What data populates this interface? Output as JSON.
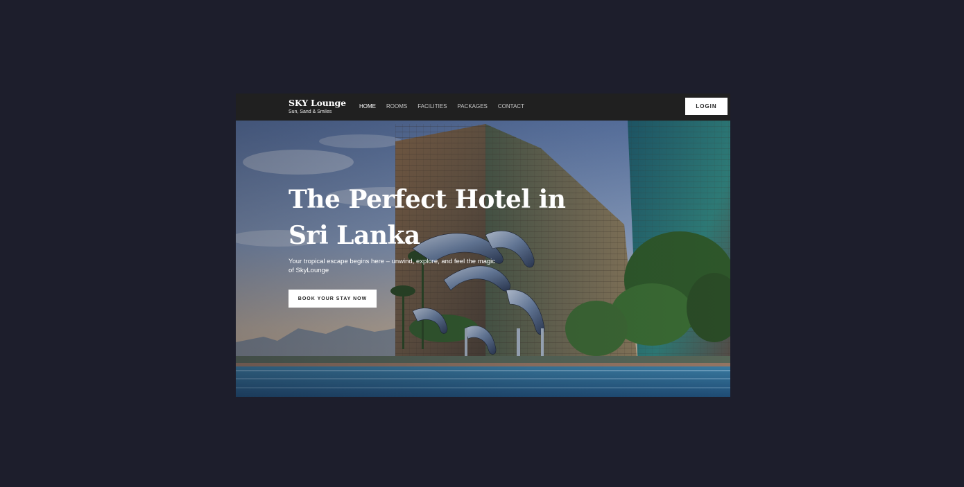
{
  "brand": {
    "name": "SKY Lounge",
    "tagline": "Sun, Sand & Smiles"
  },
  "nav": {
    "items": [
      {
        "label": "HOME",
        "active": true
      },
      {
        "label": "ROOMS",
        "active": false
      },
      {
        "label": "FACILITIES",
        "active": false
      },
      {
        "label": "PACKAGES",
        "active": false
      },
      {
        "label": "CONTACT",
        "active": false
      }
    ],
    "login_label": "LOGIN"
  },
  "hero": {
    "title": "The Perfect Hotel in Sri Lanka",
    "subtitle": "Your tropical escape begins here – unwind, explore, and feel the magic of SkyLounge",
    "cta_label": "BOOK YOUR STAY NOW",
    "image": "hotel-towers-dolphin-fountain-photo"
  },
  "colors": {
    "page_background": "#1d1e2c",
    "navbar_background": "#202020",
    "button_background": "#ffffff",
    "text_light": "#ffffff"
  }
}
